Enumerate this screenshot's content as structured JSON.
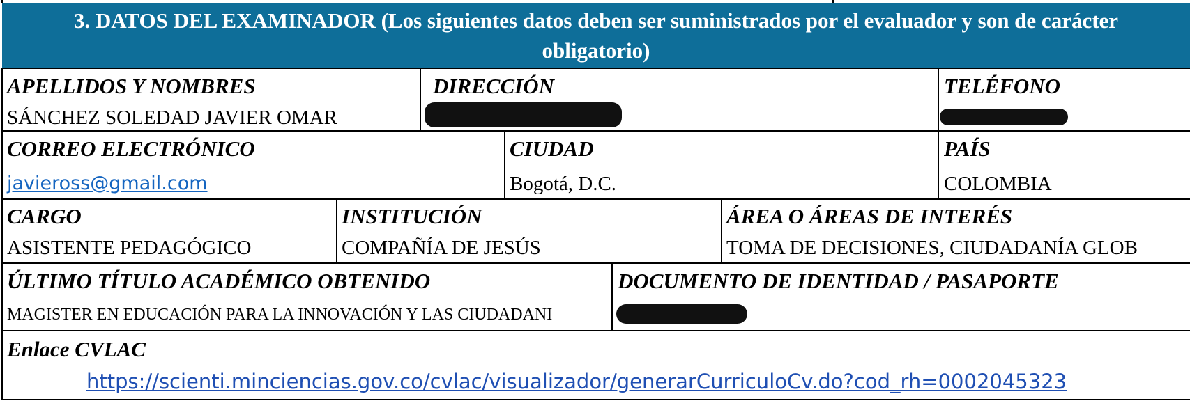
{
  "section": {
    "title": "3. DATOS DEL EXAMINADOR (Los siguientes datos deben ser suministrados por el evaluador y son de carácter\nobligatorio)"
  },
  "fields": {
    "nombres": {
      "label": "APELLIDOS Y NOMBRES",
      "value": "SÁNCHEZ SOLEDAD JAVIER OMAR"
    },
    "direccion": {
      "label": "DIRECCIÓN",
      "value": ""
    },
    "telefono": {
      "label": "TELÉFONO",
      "value": ""
    },
    "correo": {
      "label": "CORREO ELECTRÓNICO",
      "value": "javieross@gmail.com"
    },
    "ciudad": {
      "label": "CIUDAD",
      "value": "Bogotá, D.C."
    },
    "pais": {
      "label": "PAÍS",
      "value": "COLOMBIA"
    },
    "cargo": {
      "label": "CARGO",
      "value": "ASISTENTE PEDAGÓGICO"
    },
    "institucion": {
      "label": "INSTITUCIÓN",
      "value": "COMPAÑÍA DE JESÚS"
    },
    "areas": {
      "label": "ÁREA O ÁREAS DE INTERÉS",
      "value": "TOMA DE DECISIONES, CIUDADANÍA GLOB"
    },
    "titulo": {
      "label": "ÚLTIMO TÍTULO ACADÉMICO OBTENIDO",
      "value": "MAGISTER EN EDUCACIÓN PARA LA INNOVACIÓN Y LAS CIUDADANI"
    },
    "documento": {
      "label": "DOCUMENTO DE IDENTIDAD / PASAPORTE",
      "value": ""
    },
    "cvlac": {
      "label": "Enlace CVLAC",
      "value": "https://scienti.minciencias.gov.co/cvlac/visualizador/generarCurriculoCv.do?cod_rh=0002045323"
    }
  },
  "colors": {
    "header_bg": "#0e6e99",
    "header_text": "#ffffff",
    "link": "#1f4fb3",
    "redaction": "#111111"
  }
}
